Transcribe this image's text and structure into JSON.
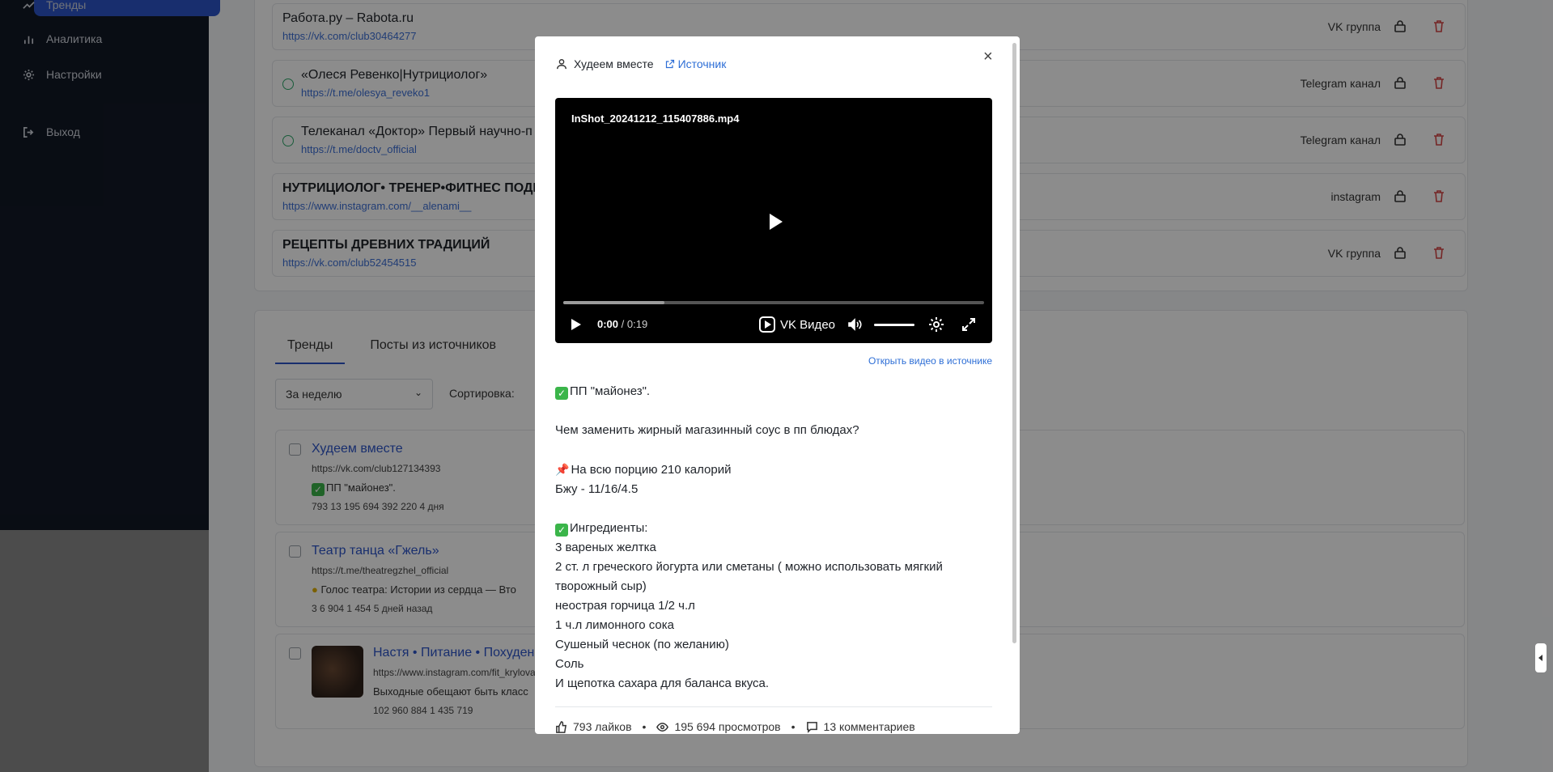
{
  "sidebar": {
    "items": [
      {
        "label": "Тренды",
        "icon": "trend-icon"
      },
      {
        "label": "Аналитика",
        "icon": "bar-chart-icon"
      },
      {
        "label": "Настройки",
        "icon": "gear-icon"
      },
      {
        "label": "Выход",
        "icon": "logout-icon"
      }
    ]
  },
  "sources": [
    {
      "name": "Работа.ру – Rabota.ru",
      "url": "https://vk.com/club30464277",
      "type": "VK группа",
      "verified": false
    },
    {
      "name": "«Олеся Ревенко|Нутрициолог»",
      "url": "https://t.me/olesya_reveko1",
      "type": "Telegram канал",
      "verified": true
    },
    {
      "name": "Телеканал «Доктор» Первый научно-п",
      "url": "https://t.me/doctv_official",
      "type": "Telegram канал",
      "verified": true
    },
    {
      "name": "НУТРИЦИОЛОГ• ТРЕНЕР•ФИТНЕС ПОДРУ",
      "url": "https://www.instagram.com/__alenami__",
      "type": "instagram",
      "verified": false
    },
    {
      "name": "РЕЦЕПТЫ ДРЕВНИХ ТРАДИЦИЙ",
      "url": "https://vk.com/club52454515",
      "type": "VK группа",
      "verified": false
    }
  ],
  "tabs": [
    {
      "label": "Тренды",
      "active": true
    },
    {
      "label": "Посты из источников",
      "active": false
    }
  ],
  "filters": {
    "period": "За неделю",
    "sort_label": "Сортировка:"
  },
  "posts": [
    {
      "title": "Худеем вместе",
      "url": "https://vk.com/club127134393",
      "excerpt": "ПП \"майонез\".",
      "stats": "793   13   195 694   392 220   4 дня"
    },
    {
      "title": "Театр танца «Гжель»",
      "url": "https://t.me/theatregzhel_official",
      "excerpt": "Голос театра: Истории из сердца — Вто",
      "stats": "3   6   904   1 454   5 дней назад"
    },
    {
      "title": "Настя • Питание • Похуден",
      "url": "https://www.instagram.com/fit_krylova",
      "excerpt": "Выходные обещают быть класс",
      "stats": "102 960   884   1 435 719"
    }
  ],
  "modal": {
    "author": "Худеем вместе",
    "source_link": "Источник",
    "close": "×",
    "video": {
      "filename": "InShot_20241212_115407886.mp4",
      "current_time": "0:00",
      "duration": "/ 0:19",
      "brand": "VK Видео",
      "progress_buffered": 0.24
    },
    "open_video_link": "Открыть видео в источнике",
    "text": {
      "l1": "ПП \"майонез\".",
      "l2": "Чем заменить жирный магазинный соус в пп блюдах?",
      "l3": "На всю порцию 210 калорий",
      "l4": "Бжу - 11/16/4.5",
      "l5": "Ингредиенты:",
      "l6": "3 вареных желтка",
      "l7": "2 ст. л греческого йогурта или сметаны ( можно использовать мягкий творожный сыр)",
      "l8": "неострая горчица 1/2 ч.л",
      "l9": "1 ч.л лимонного сока",
      "l10": "Сушеный чеснок (по желанию)",
      "l11": "Соль",
      "l12": "И щепотка сахара для баланса вкуса."
    },
    "stats": {
      "likes": "793 лайков",
      "views": "195 694 просмотров",
      "comments": "13 комментариев",
      "separator": "•"
    }
  }
}
